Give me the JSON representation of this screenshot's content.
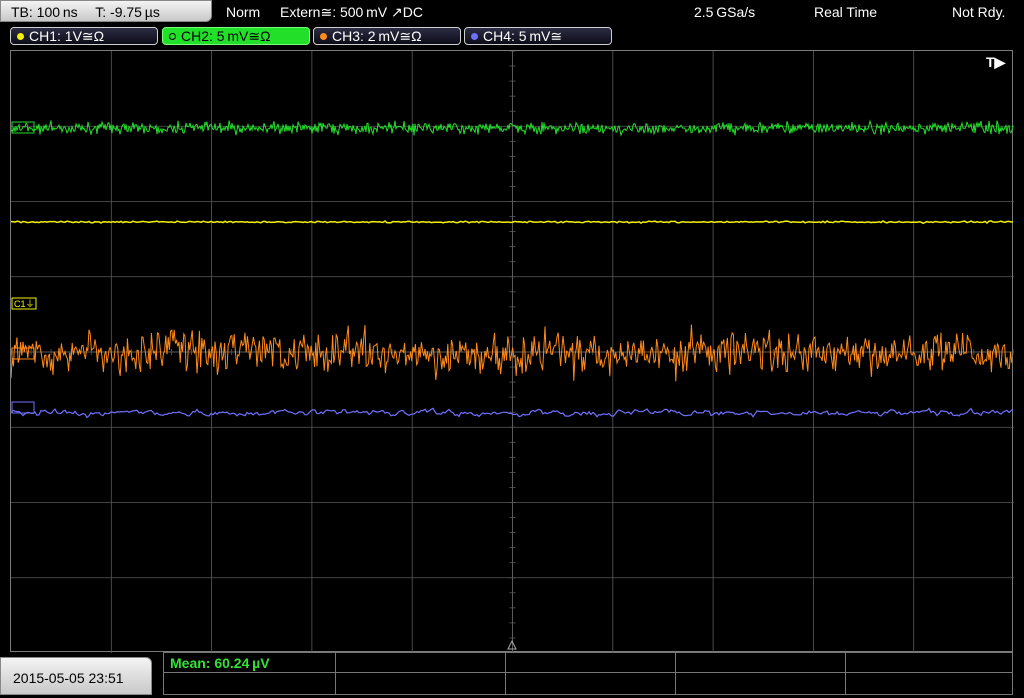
{
  "status_bar": {
    "timebase": "TB: 100 ns",
    "trigger_time": "T: -9.75 µs",
    "mode": "Norm",
    "trigger_source": "Extern≅: 500 mV ↗DC",
    "sample_rate": "2.5 GSa/s",
    "acq_mode": "Real Time",
    "trigger_status": "Not Rdy."
  },
  "channels": [
    {
      "label": "CH1: 1V≅Ω",
      "color": "#f2f200",
      "active": false
    },
    {
      "label": "CH2: 5 mV≅Ω",
      "color": "#22e02a",
      "active": true
    },
    {
      "label": "CH3: 2 mV≅Ω",
      "color": "#ff8a1a",
      "active": false
    },
    {
      "label": "CH4: 5 mV≅",
      "color": "#7070ff",
      "active": false
    }
  ],
  "markers": {
    "trigger_pos": "T▶",
    "c1_level": "C1⏚"
  },
  "datetime": "2015-05-05 23:51",
  "measurement": {
    "label": "Mean: 60.24 µV"
  },
  "colors": {
    "grid": "#5a5a5a",
    "ch1": "#f2f200",
    "ch2": "#22e02a",
    "ch3": "#ff8a1a",
    "ch4": "#7070ff"
  }
}
